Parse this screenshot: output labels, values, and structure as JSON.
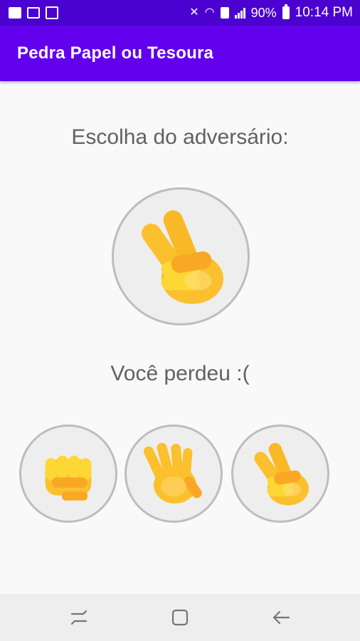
{
  "status_bar": {
    "battery_percent": "90%",
    "time": "10:14 PM",
    "icons": [
      "notification-icon",
      "image-icon",
      "usb-icon",
      "mute-icon",
      "wifi-icon",
      "nfc-icon",
      "signal-icon",
      "battery-icon"
    ]
  },
  "app_bar": {
    "title": "Pedra Papel ou Tesoura"
  },
  "main": {
    "prompt": "Escolha do adversário:",
    "opponent_choice_icon": "victory-hand-icon",
    "result": "Você perdeu :(",
    "choices": [
      {
        "id": "rock",
        "icon": "raised-fist-icon"
      },
      {
        "id": "paper",
        "icon": "raised-hand-icon"
      },
      {
        "id": "scissors",
        "icon": "victory-hand-icon"
      }
    ]
  },
  "nav_bar": {
    "icons": [
      "recents-icon",
      "home-icon",
      "back-icon"
    ]
  },
  "colors": {
    "status_bar": "#4b01cf",
    "app_bar": "#6200ee",
    "emoji_yellow": "#fbc02d",
    "background": "#f9f9f9"
  }
}
